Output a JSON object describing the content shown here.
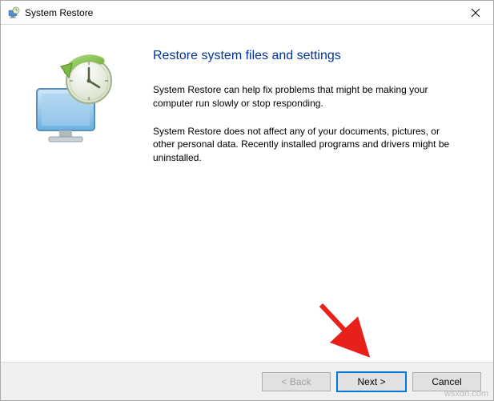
{
  "window": {
    "title": "System Restore"
  },
  "content": {
    "heading": "Restore system files and settings",
    "paragraph1": "System Restore can help fix problems that might be making your computer run slowly or stop responding.",
    "paragraph2": "System Restore does not affect any of your documents, pictures, or other personal data. Recently installed programs and drivers might be uninstalled."
  },
  "buttons": {
    "back": "< Back",
    "next": "Next >",
    "cancel": "Cancel"
  },
  "watermark": "wsxdn.com"
}
